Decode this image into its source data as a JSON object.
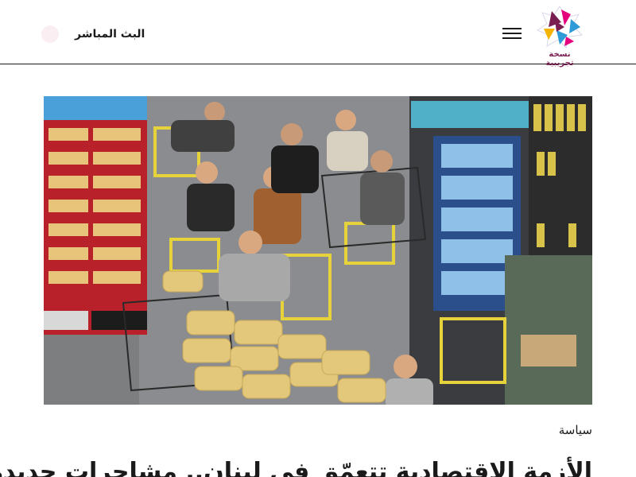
{
  "header": {
    "logo_caption": "نسخة تجريبية",
    "live_label": "البث المباشر"
  },
  "article": {
    "category": "سياسة",
    "headline": "الأزمة الاقتصادية تتعمّق في لبنان.. مشاجرات جديدة"
  },
  "colors": {
    "logo_purple": "#7a1e52",
    "logo_pink": "#e5007e",
    "logo_blue": "#2e9ad8",
    "logo_yellow": "#f5b400",
    "live_dot": "#fbeef3"
  },
  "icons": {
    "logo": "station-logo-icon",
    "menu": "hamburger-menu-icon",
    "live": "live-dot-icon"
  }
}
